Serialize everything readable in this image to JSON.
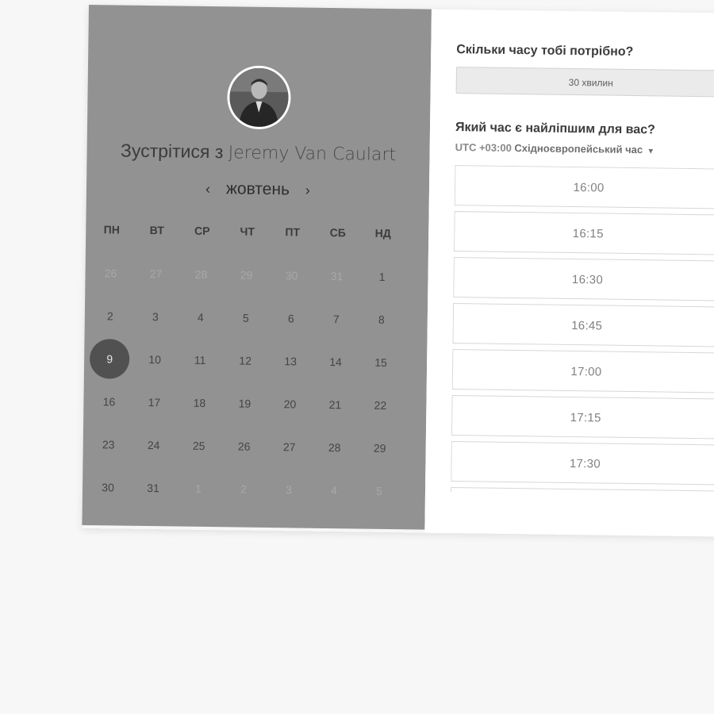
{
  "calendar": {
    "title_prefix": "Зустрітися з",
    "host_name": "Jeremy Van Caulart",
    "month": "жовтень",
    "prev_arrow": "‹",
    "next_arrow": "›",
    "weekdays": [
      "ПН",
      "ВТ",
      "СР",
      "ЧТ",
      "ПТ",
      "СБ",
      "НД"
    ],
    "weeks": [
      [
        "26",
        "27",
        "28",
        "29",
        "30",
        "31",
        "1"
      ],
      [
        "2",
        "3",
        "4",
        "5",
        "6",
        "7",
        "8"
      ],
      [
        "9",
        "10",
        "11",
        "12",
        "13",
        "14",
        "15"
      ],
      [
        "16",
        "17",
        "18",
        "19",
        "20",
        "21",
        "22"
      ],
      [
        "23",
        "24",
        "25",
        "26",
        "27",
        "28",
        "29"
      ],
      [
        "30",
        "31",
        "1",
        "2",
        "3",
        "4",
        "5"
      ]
    ],
    "selected_day": "9",
    "colors": {
      "panel": "#929292",
      "selected": "#515151"
    }
  },
  "booking": {
    "duration_question": "Скільки часу тобі потрібно?",
    "duration_value": "30 хвилин",
    "time_question": "Який час є найліпшим для вас?",
    "timezone_offset": "UTC +03:00",
    "timezone_name": "Східноєвропейський час",
    "timezone_caret": "▾",
    "slots": [
      "16:00",
      "16:15",
      "16:30",
      "16:45",
      "17:00",
      "17:15",
      "17:30"
    ]
  },
  "icons": {
    "avatar": "host-avatar-photo",
    "caret": "caret-down-icon"
  }
}
